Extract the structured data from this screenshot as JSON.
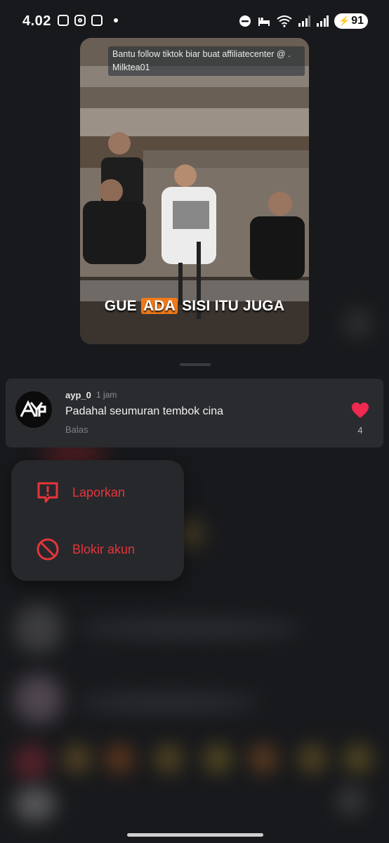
{
  "status_bar": {
    "time": "4.02",
    "battery": "91"
  },
  "video": {
    "caption_top": "Bantu follow tiktok biar buat affiliatecenter @ . Milktea01",
    "subtitle_pre": "GUE ",
    "subtitle_highlight": "ADA",
    "subtitle_post": " SISI ITU JUGA"
  },
  "comment": {
    "username": "ayp_0",
    "time": "1 jam",
    "text": "Padahal seumuran tembok cina",
    "reply_label": "Balas",
    "like_count": "4",
    "avatar_text": "AYP"
  },
  "menu": {
    "report_label": "Laporkan",
    "block_label": "Blokir akun"
  },
  "colors": {
    "danger": "#e5353b",
    "like": "#ef2950",
    "card": "#2a2b2f",
    "background": "#18191c"
  },
  "icons": {
    "report": "report-icon",
    "block": "block-icon",
    "like": "heart-icon"
  }
}
